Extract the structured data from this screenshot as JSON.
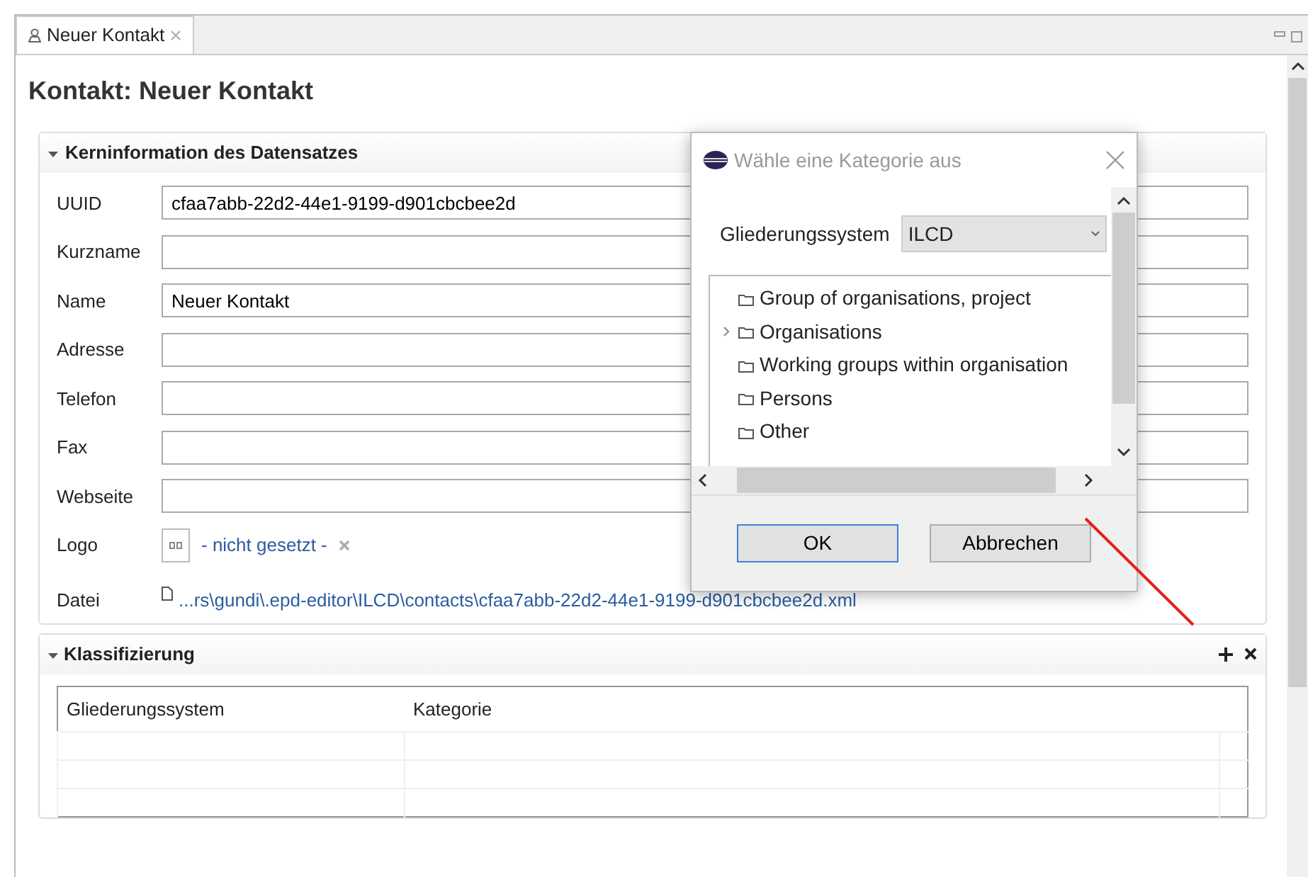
{
  "editor_tab": {
    "label": "Neuer Kontakt",
    "selected": true
  },
  "heading": "Kontakt: Neuer Kontakt",
  "core_section": {
    "title": "Kerninformation des Datensatzes",
    "expanded": true,
    "fields": [
      {
        "kind": "text",
        "label": "UUID",
        "value": "cfaa7abb-22d2-44e1-9199-d901cbcbee2d"
      },
      {
        "kind": "text",
        "label": "Kurzname"
      },
      {
        "kind": "text",
        "label": "Name",
        "value": "Neuer Kontakt"
      },
      {
        "kind": "text",
        "label": "Adresse"
      },
      {
        "kind": "text",
        "label": "Telefon"
      },
      {
        "kind": "text",
        "label": "Fax"
      },
      {
        "kind": "text",
        "label": "Webseite"
      },
      {
        "kind": "logo",
        "label": "Logo",
        "link": "- nicht gesetzt -"
      },
      {
        "kind": "file",
        "label": "Datei",
        "link": "...rs\\gundi\\.epd-editor\\ILCD\\contacts\\cfaa7abb-22d2-44e1-9199-d901cbcbee2d.xml"
      }
    ]
  },
  "classification_section": {
    "title": "Klassifizierung",
    "expanded": true,
    "table": {
      "columns": [
        "Gliederungssystem",
        "Kategorie"
      ]
    }
  },
  "dialog": {
    "title": "Wähle eine Kategorie aus",
    "system_label": "Gliederungssystem",
    "system_value": "ILCD",
    "tree": [
      {
        "label": "Group of organisations, project",
        "has_children": false
      },
      {
        "label": "Organisations",
        "has_children": true
      },
      {
        "label": "Working groups within organisation",
        "has_children": false
      },
      {
        "label": "Persons",
        "has_children": false
      },
      {
        "label": "Other",
        "has_children": false
      }
    ],
    "buttons": [
      {
        "label": "OK",
        "focused": true
      },
      {
        "label": "Abbrechen",
        "focused": false
      }
    ]
  }
}
